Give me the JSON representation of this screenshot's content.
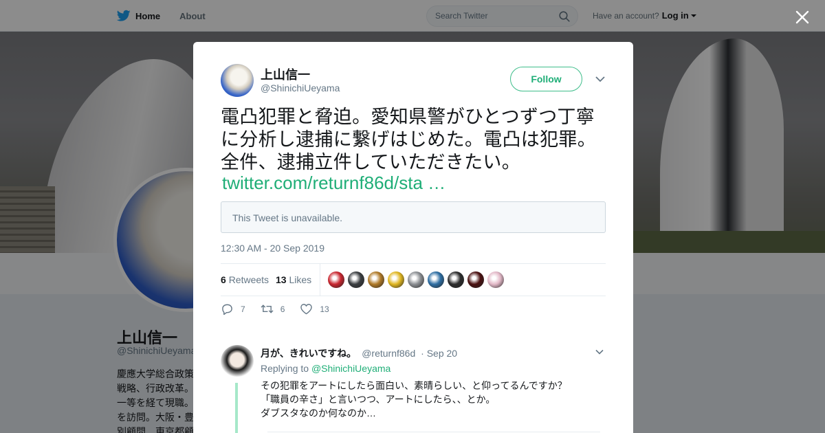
{
  "nav": {
    "home_label": "Home",
    "about_label": "About",
    "search_placeholder": "Search Twitter",
    "account_prompt": "Have an account?",
    "login_label": "Log in"
  },
  "profile": {
    "name": "上山信一",
    "handle": "@ShinichiUeyama",
    "bio_lines": [
      "慶應大学総合政策",
      "戦略、行政改革。",
      "一等を経て現職。",
      "を訪問。大阪・豊",
      "別顧問、東京都顧"
    ]
  },
  "tweet": {
    "author_name": "上山信一",
    "author_handle": "@ShinichiUeyama",
    "follow_label": "Follow",
    "text_lines": [
      "電凸犯罪と脅迫。愛知県警がひとつずつ丁寧",
      "に分析し逮捕に繋げはじめた。電凸は犯罪。",
      "全件、逮捕立件していただきたい。"
    ],
    "link": "twitter.com/returnf86d/sta …",
    "quote_unavailable": "This Tweet is unavailable.",
    "timestamp": "12:30 AM - 20 Sep 2019",
    "retweet_count": "6",
    "retweet_label": "Retweets",
    "like_count": "13",
    "like_label": "Likes",
    "liker_colors": [
      "#c9262f",
      "#3a3d40",
      "#b07a28",
      "#e0b620",
      "#8b8e92",
      "#2e6ea3",
      "#2b2b2b",
      "#4a1010",
      "#e3b9c8"
    ],
    "reply_action_count": "7",
    "retweet_action_count": "6",
    "like_action_count": "13"
  },
  "reply": {
    "name": "月が、きれいですね。",
    "handle": "@returnf86d",
    "date": "· Sep 20",
    "replying_prefix": "Replying to",
    "replying_handle": "@ShinichiUeyama",
    "text_lines": [
      "その犯罪をアートにしたら面白い、素晴らしい、と仰ってるんですか？",
      "「職員の辛さ」と言いつつ、アートにしたら、、とか。",
      "ダブスタなのか何なのか…"
    ]
  }
}
